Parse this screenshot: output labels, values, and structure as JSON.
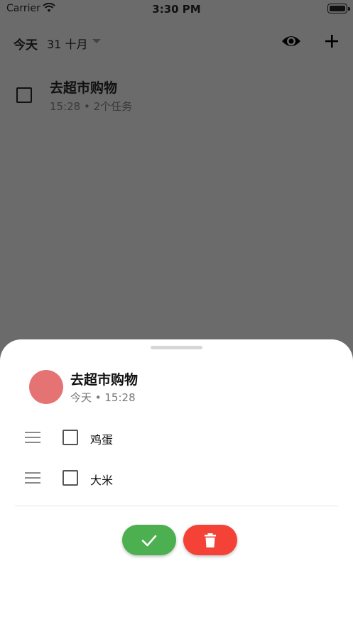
{
  "status_bar": {
    "carrier": "Carrier",
    "time": "3:30 PM"
  },
  "header": {
    "today_label": "今天",
    "date_label": "31 十月"
  },
  "task": {
    "title": "去超市购物",
    "meta": "15:28  • 2个任务"
  },
  "sheet": {
    "title": "去超市购物",
    "subtitle": "今天 • 15:28",
    "avatar_color": "#e57373",
    "items": [
      {
        "label": "鸡蛋",
        "checked": false
      },
      {
        "label": "大米",
        "checked": false
      }
    ],
    "done_color": "#4caf50",
    "delete_color": "#f44336"
  },
  "icons": {
    "visibility": "eye-icon",
    "add": "plus-icon",
    "done": "check-icon",
    "delete": "trash-icon",
    "drag": "drag-handle-icon"
  }
}
